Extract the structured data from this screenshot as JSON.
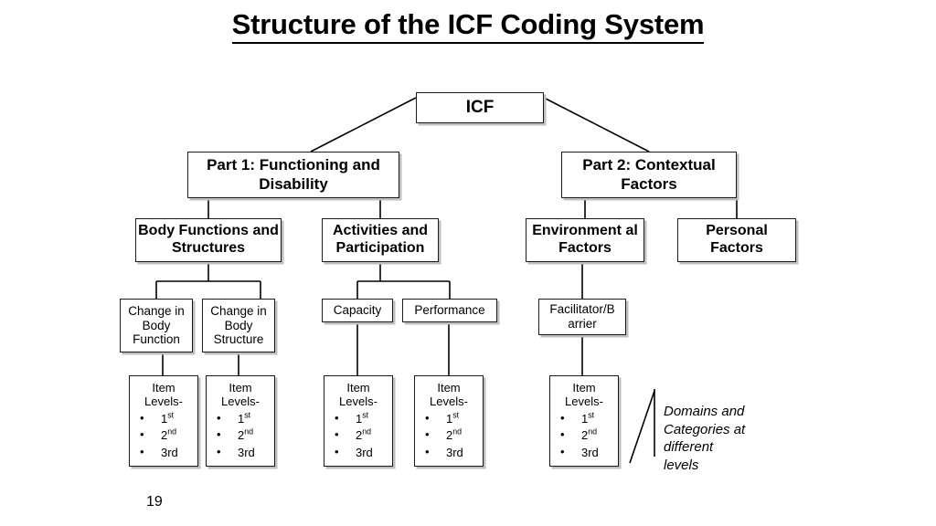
{
  "slide": {
    "title": "Structure of the ICF Coding System",
    "page_number": "19",
    "annotation": "Domains and\nCategories at\ndifferent\nlevels",
    "colors": {
      "text": "#000000",
      "background": "#ffffff",
      "border": "#1a1a1a",
      "shadow": "#bfbfbf"
    }
  },
  "nodes": {
    "root": {
      "label": "ICF"
    },
    "part1": {
      "label": "Part 1: Functioning and Disability"
    },
    "part2": {
      "label": "Part 2: Contextual Factors"
    },
    "body_functions": {
      "label": "Body Functions and Structures"
    },
    "activities": {
      "label": "Activities and Participation"
    },
    "environmental": {
      "label": "Environment al Factors"
    },
    "personal": {
      "label": "Personal Factors"
    },
    "change_function": {
      "label": "Change in Body Function"
    },
    "change_structure": {
      "label": "Change in Body Structure"
    },
    "capacity": {
      "label": "Capacity"
    },
    "performance": {
      "label": "Performance"
    },
    "facilitator": {
      "label": "Facilitator/B arrier"
    }
  },
  "item_levels": {
    "head_line1": "Item",
    "head_line2": "Levels-",
    "bullets": [
      {
        "num": "1",
        "suffix": "st",
        "super": true
      },
      {
        "num": "2",
        "suffix": "nd",
        "super": true
      },
      {
        "num": "3rd",
        "suffix": "",
        "super": false
      }
    ]
  }
}
